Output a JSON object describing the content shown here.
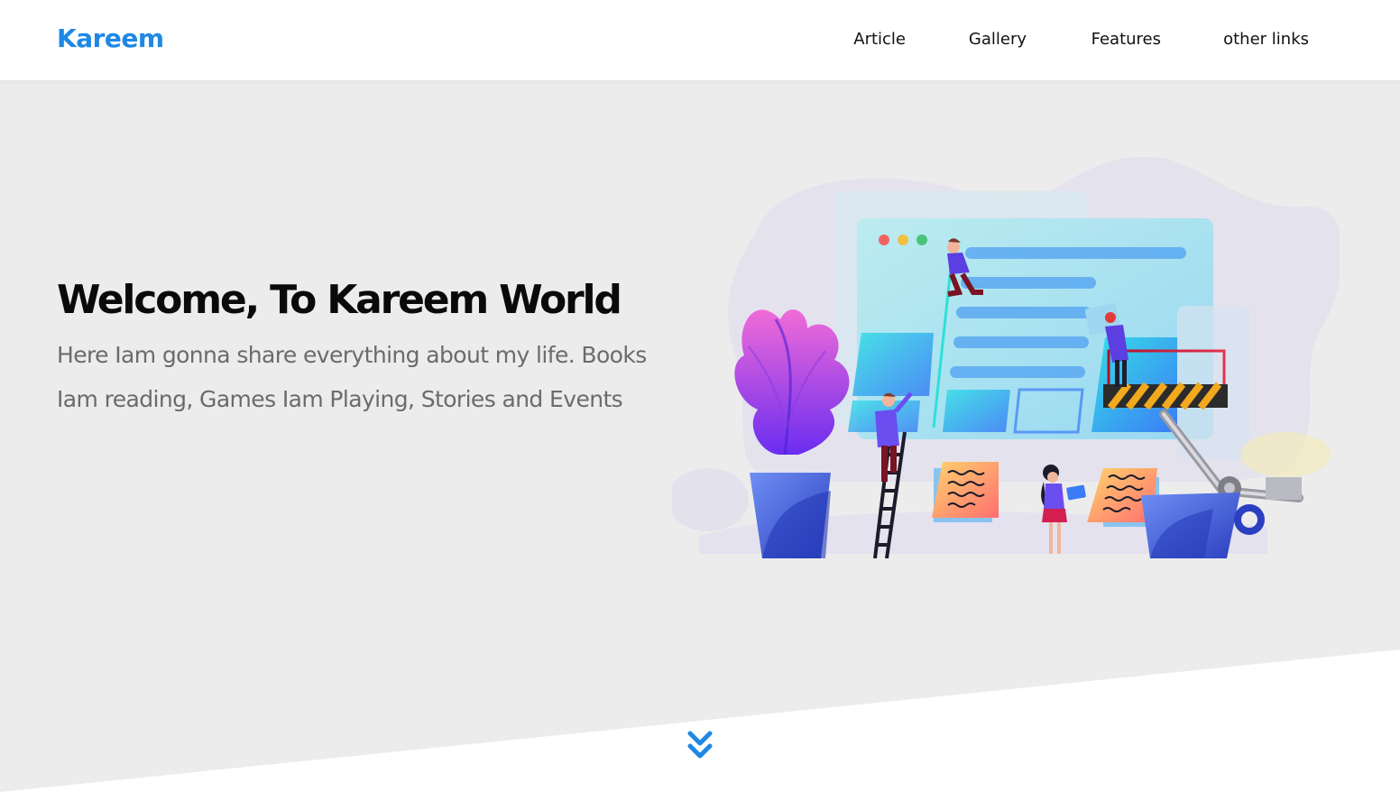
{
  "header": {
    "logo": "Kareem",
    "nav": [
      {
        "label": "Article"
      },
      {
        "label": "Gallery"
      },
      {
        "label": "Features"
      },
      {
        "label": "other links"
      }
    ]
  },
  "hero": {
    "title": "Welcome, To Kareem World",
    "text": "Here Iam gonna share everything about my life. Books Iam reading, Games Iam Playing, Stories and Events",
    "illustration_icon": "web-development-team-illustration",
    "scroll_icon": "double-chevron-down-icon"
  },
  "colors": {
    "accent": "#1e88e5",
    "hero_background": "#ececec",
    "header_background": "#ffffff",
    "title": "#0a0a0a",
    "body_text": "#6b6b6b"
  }
}
